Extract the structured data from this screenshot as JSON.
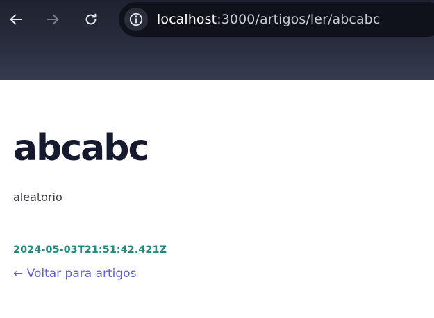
{
  "browser": {
    "url_host": "localhost",
    "url_path": ":3000/artigos/ler/abcabc",
    "icons": {
      "back": "arrow-left-icon",
      "forward": "arrow-right-icon",
      "reload": "reload-icon",
      "site_info": "info-icon"
    }
  },
  "article": {
    "title": "abcabc",
    "body": "aleatorio",
    "created_at": "2024-05-03T21:51:42.421Z",
    "back_link": "← Voltar para artigos"
  },
  "colors": {
    "title": "#151a2e",
    "timestamp": "#1f8a7e",
    "link": "#5f5ed9",
    "toolbar": "#262a3a"
  }
}
